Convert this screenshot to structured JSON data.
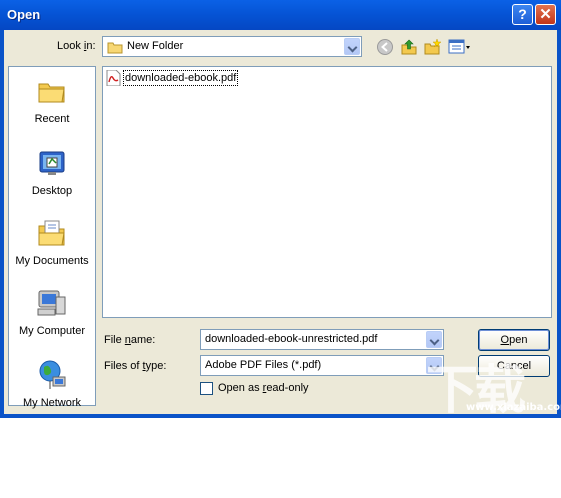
{
  "window": {
    "title": "Open",
    "help_button": "?",
    "close_button": "✕"
  },
  "toolbar": {
    "look_in_prefix": "Look ",
    "look_in_ul": "i",
    "look_in_suffix": "n:",
    "look_in_value": "New Folder",
    "icons": [
      "back-icon",
      "up-folder-icon",
      "new-folder-icon",
      "view-menu-icon"
    ]
  },
  "places": [
    {
      "label": "Recent",
      "icon": "recent-icon"
    },
    {
      "label": "Desktop",
      "icon": "desktop-icon"
    },
    {
      "label": "My Documents",
      "icon": "my-documents-icon"
    },
    {
      "label": "My Computer",
      "icon": "my-computer-icon"
    },
    {
      "label": "My Network",
      "icon": "my-network-icon"
    }
  ],
  "files": [
    {
      "name": "downloaded-ebook.pdf",
      "icon": "pdf-file-icon"
    }
  ],
  "filename": {
    "label_prefix": "File ",
    "label_ul": "n",
    "label_suffix": "ame:",
    "value": "downloaded-ebook-unrestricted.pdf"
  },
  "filetype": {
    "label_prefix": "Files of ",
    "label_ul": "t",
    "label_suffix": "ype:",
    "value": "Adobe PDF Files (*.pdf)"
  },
  "readonly": {
    "label_prefix": "Open as ",
    "label_ul": "r",
    "label_suffix": "ead-only",
    "checked": false
  },
  "buttons": {
    "open_ul": "O",
    "open_rest": "pen",
    "cancel": "Cancel"
  },
  "watermark": {
    "big": "下载吧",
    "small": "www.xiazaiba.com"
  },
  "colors": {
    "titlebar": "#0553d4",
    "dialog_bg": "#ece9d8",
    "border": "#7f9db9"
  }
}
